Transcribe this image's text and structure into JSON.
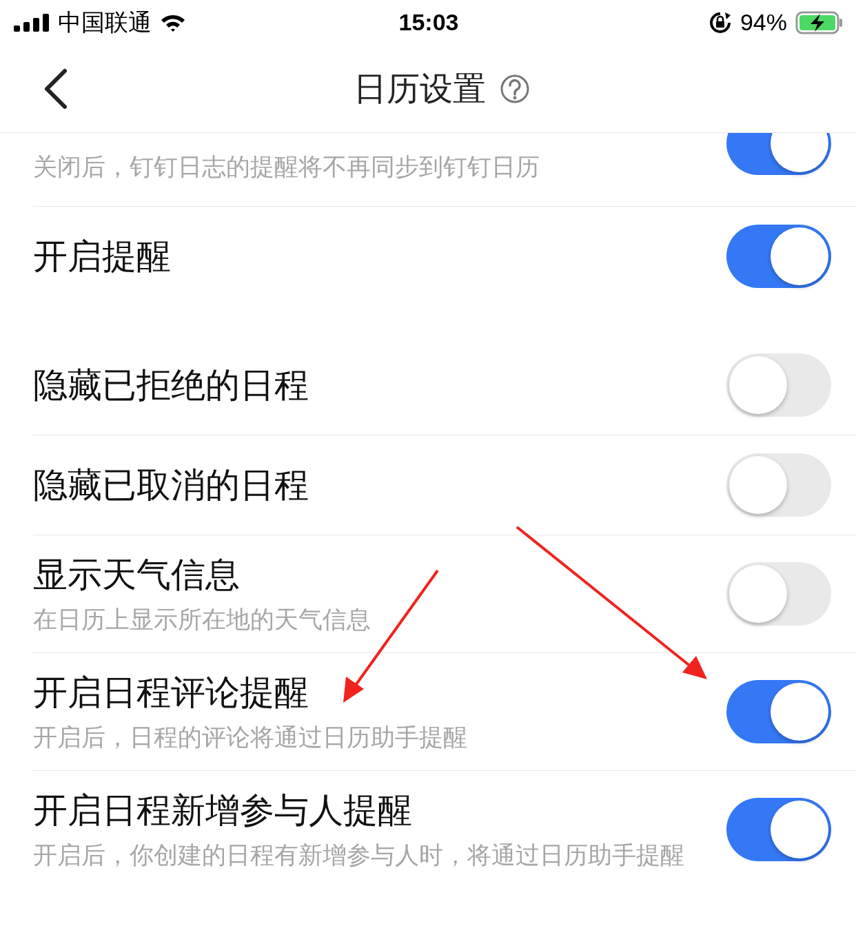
{
  "status_bar": {
    "carrier": "中国联通",
    "time": "15:03",
    "battery": "94%"
  },
  "nav": {
    "title": "日历设置"
  },
  "groups": [
    {
      "rows": [
        {
          "kind": "cut",
          "description": "关闭后，钉钉日志的提醒将不再同步到钉钉日历",
          "on": true
        },
        {
          "kind": "full",
          "title": "开启提醒",
          "on": true
        }
      ]
    },
    {
      "rows": [
        {
          "kind": "full",
          "title": "隐藏已拒绝的日程",
          "on": false
        },
        {
          "kind": "full",
          "title": "隐藏已取消的日程",
          "on": false
        },
        {
          "kind": "full",
          "title": "显示天气信息",
          "description": "在日历上显示所在地的天气信息",
          "on": false
        },
        {
          "kind": "full",
          "title": "开启日程评论提醒",
          "description": "开启后，日程的评论将通过日历助手提醒",
          "on": true
        },
        {
          "kind": "full",
          "title": "开启日程新增参与人提醒",
          "description": "开启后，你创建的日程有新增参与人时，将通过日历助手提醒",
          "on": true
        }
      ]
    }
  ]
}
